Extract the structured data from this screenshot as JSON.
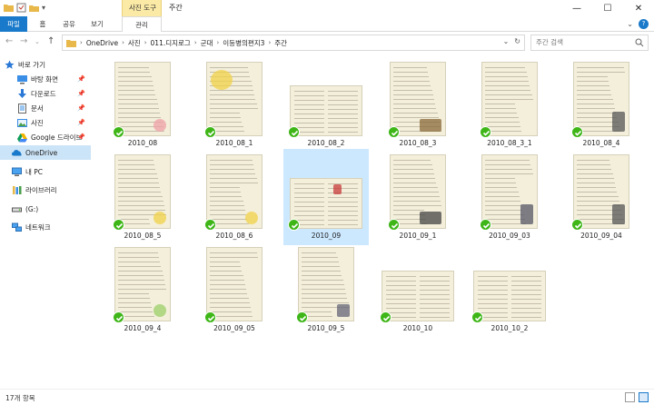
{
  "window": {
    "title": "주간",
    "context_tab_group": "사진 도구",
    "buttons": [
      "—",
      "☐",
      "✕"
    ]
  },
  "ribbon": {
    "tabs": [
      {
        "label": "파일"
      },
      {
        "label": "홈"
      },
      {
        "label": "공유"
      },
      {
        "label": "보기"
      },
      {
        "label": "관리"
      }
    ],
    "help": "?"
  },
  "address": {
    "breadcrumbs": [
      "OneDrive",
      "사진",
      "011.디지로그",
      "군대",
      "이등병의편지3",
      "주간"
    ],
    "search_placeholder": "주간 검색"
  },
  "sidebar": {
    "items": [
      {
        "label": "바로 가기",
        "icon": "star-icon",
        "pinned": false
      },
      {
        "label": "바탕 화면",
        "icon": "desktop-icon",
        "pinned": true
      },
      {
        "label": "다운로드",
        "icon": "download-icon",
        "pinned": true
      },
      {
        "label": "문서",
        "icon": "document-icon",
        "pinned": true
      },
      {
        "label": "사진",
        "icon": "pictures-icon",
        "pinned": true
      },
      {
        "label": "Google 드라이브",
        "icon": "google-drive-icon",
        "pinned": true
      },
      {
        "label": "OneDrive",
        "icon": "onedrive-icon",
        "pinned": false
      },
      {
        "label": "내 PC",
        "icon": "pc-icon",
        "pinned": false
      },
      {
        "label": "라이브러리",
        "icon": "library-icon",
        "pinned": false
      },
      {
        "label": "(G:)",
        "icon": "drive-icon",
        "pinned": false
      },
      {
        "label": "네트워크",
        "icon": "network-icon",
        "pinned": false
      }
    ],
    "pin_glyph": "📌"
  },
  "files": [
    {
      "name": "2010_08",
      "orientation": "portrait",
      "deco": "flower-pink"
    },
    {
      "name": "2010_08_1",
      "orientation": "portrait",
      "deco": "flower-yellow"
    },
    {
      "name": "2010_08_2",
      "orientation": "landscape",
      "deco": "none"
    },
    {
      "name": "2010_08_3",
      "orientation": "portrait",
      "deco": "hut"
    },
    {
      "name": "2010_08_3_1",
      "orientation": "portrait",
      "deco": "none"
    },
    {
      "name": "2010_08_4",
      "orientation": "portrait",
      "deco": "fence"
    },
    {
      "name": "2010_08_5",
      "orientation": "portrait",
      "deco": "flower-yellow"
    },
    {
      "name": "2010_08_6",
      "orientation": "portrait",
      "deco": "flower-yellow"
    },
    {
      "name": "2010_09",
      "orientation": "landscape",
      "deco": "mailbox",
      "selected": true
    },
    {
      "name": "2010_09_1",
      "orientation": "portrait",
      "deco": "bench"
    },
    {
      "name": "2010_09_03",
      "orientation": "portrait",
      "deco": "tree"
    },
    {
      "name": "2010_09_04",
      "orientation": "portrait",
      "deco": "fence"
    },
    {
      "name": "2010_09_4",
      "orientation": "portrait",
      "deco": "flower-green"
    },
    {
      "name": "2010_09_05",
      "orientation": "portrait",
      "deco": "none"
    },
    {
      "name": "2010_09_5",
      "orientation": "portrait",
      "deco": "plant"
    },
    {
      "name": "2010_10",
      "orientation": "landscape",
      "deco": "none"
    },
    {
      "name": "2010_10_2",
      "orientation": "landscape",
      "deco": "none"
    }
  ],
  "status": {
    "item_count": "17개 항목"
  },
  "colors": {
    "accent": "#1979ca",
    "context_tab": "#fbeaa6",
    "selection": "#cce8ff",
    "sync_check": "#3fb618",
    "paper": "#f3efdb"
  }
}
